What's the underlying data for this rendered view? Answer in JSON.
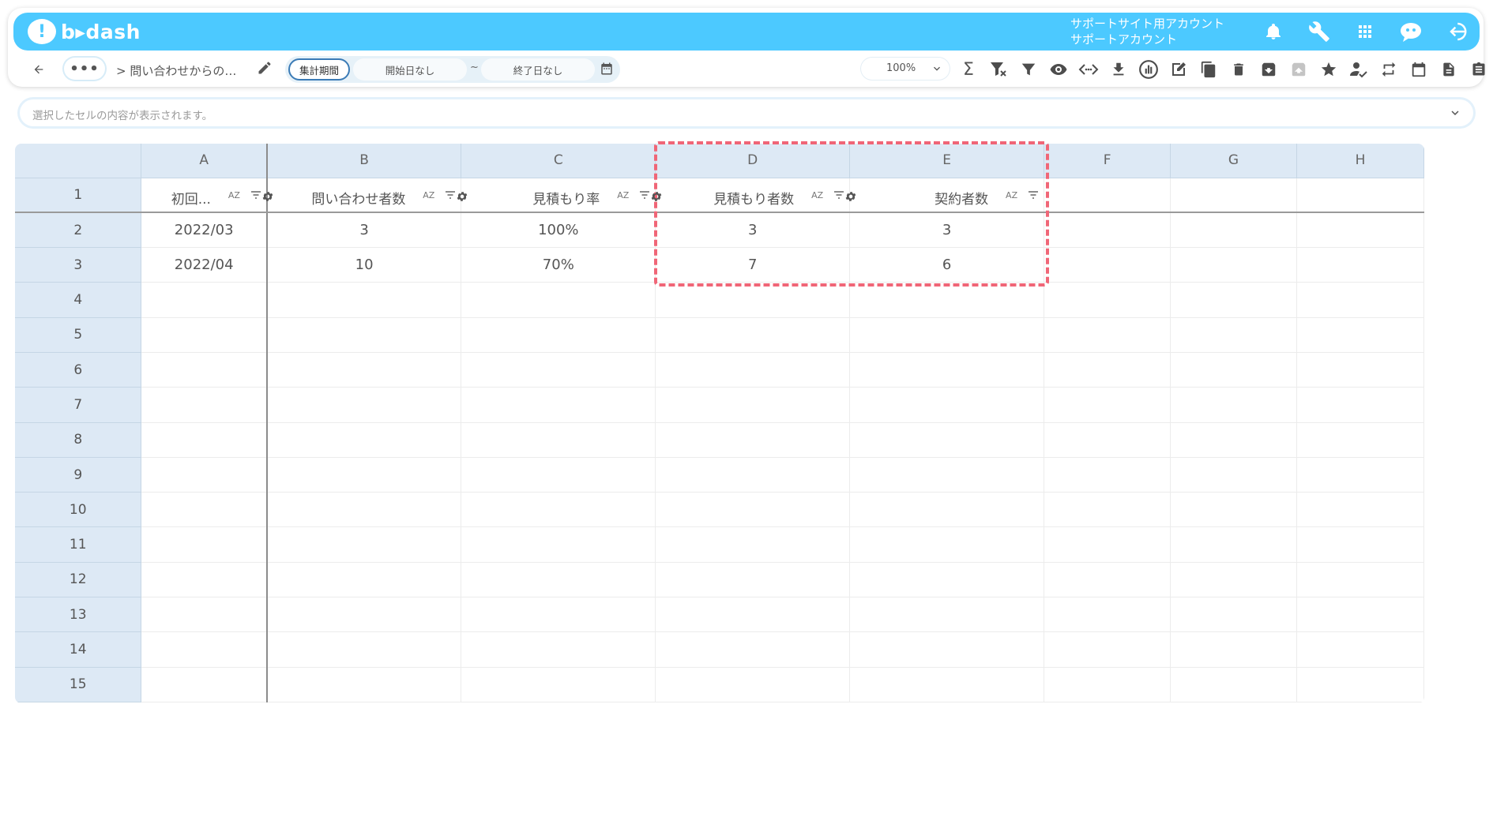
{
  "header": {
    "logo_text": "b▸dash",
    "account_line1": "サポートサイト用アカウント",
    "account_line2": "サポートアカウント",
    "icons": [
      "bell-icon",
      "wrench-icon",
      "apps-grid-icon",
      "chat-bot-icon",
      "logout-icon"
    ]
  },
  "toolbar": {
    "breadcrumb": "> 問い合わせからの…",
    "more_label": "•••",
    "period_tag": "集計期間",
    "start_date": "開始日なし",
    "tilde": "~",
    "end_date": "終了日なし",
    "zoom": "100%",
    "tools": [
      "sum-icon",
      "filter-clear-icon",
      "filter-icon",
      "eye-icon",
      "code-icon",
      "download-icon",
      "chart-icon",
      "edit-note-icon",
      "copy-icon",
      "delete-icon",
      "archive-icon",
      "unarchive-icon",
      "star-icon",
      "user-check-icon",
      "repeat-icon",
      "calendar-icon",
      "document-icon",
      "clipboard-icon"
    ]
  },
  "formula_bar": {
    "placeholder": "選択したセルの内容が表示されます。"
  },
  "sheet": {
    "columns": [
      "A",
      "B",
      "C",
      "D",
      "E",
      "F",
      "G",
      "H"
    ],
    "rows": [
      "1",
      "2",
      "3",
      "4",
      "5",
      "6",
      "7",
      "8",
      "9",
      "10",
      "11",
      "12",
      "13",
      "14",
      "15"
    ],
    "header_labels": [
      "初回...",
      "問い合わせ者数",
      "見積もり率",
      "見積もり者数",
      "契約者数"
    ],
    "sort_label": "AZ",
    "data": [
      [
        "2022/03",
        "3",
        "100%",
        "3",
        "3"
      ],
      [
        "2022/04",
        "10",
        "70%",
        "7",
        "6"
      ]
    ]
  },
  "colors": {
    "topbar": "#4cc9ff",
    "header_bg": "#dde9f5",
    "highlight": "#f06677"
  }
}
